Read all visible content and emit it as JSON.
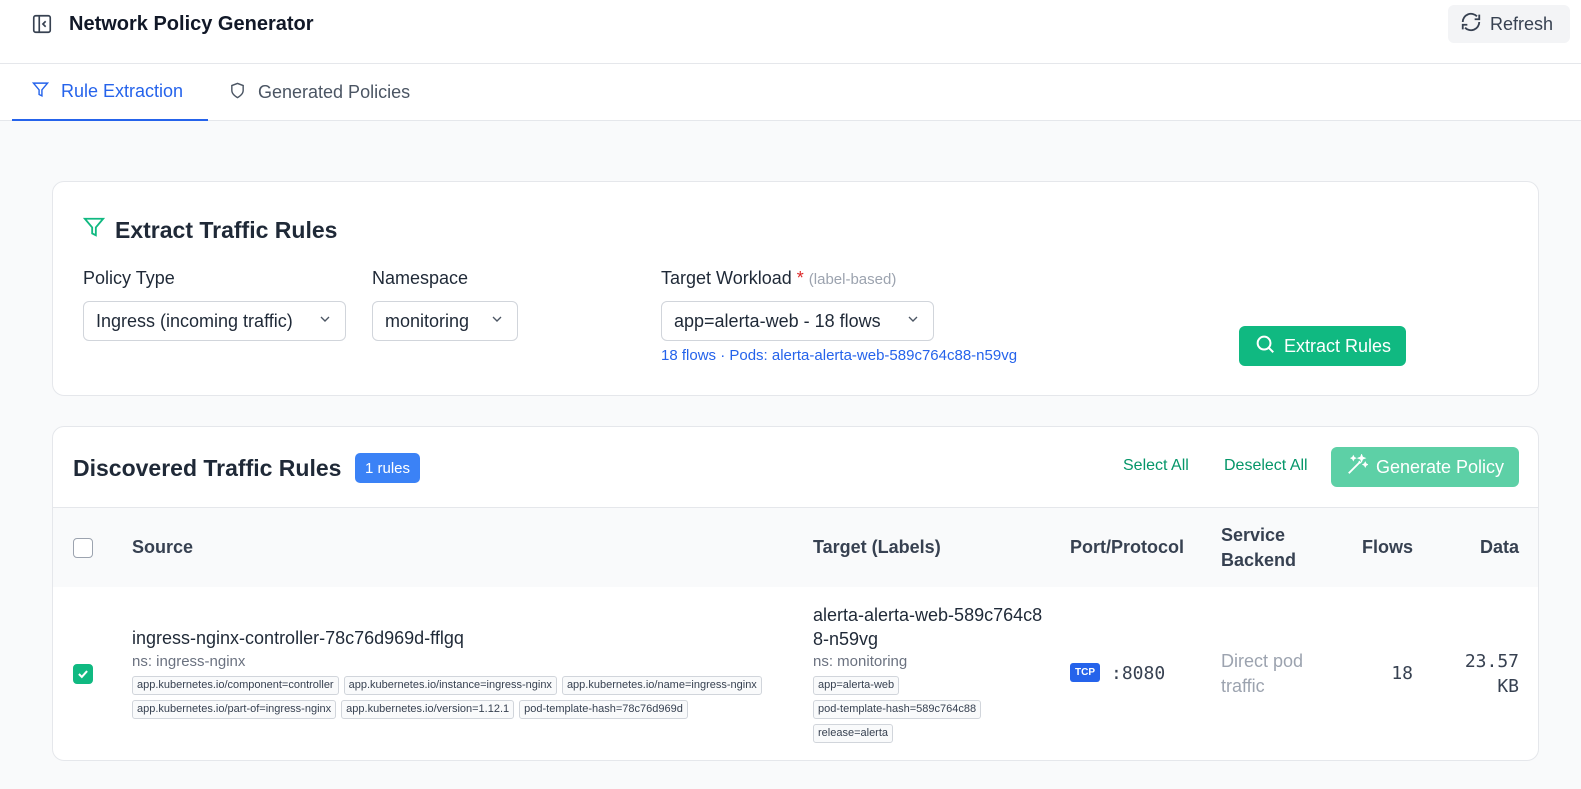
{
  "header": {
    "title": "Network Policy Generator",
    "refresh_label": "Refresh"
  },
  "tabs": [
    {
      "label": "Rule Extraction",
      "active": true,
      "icon": "filter-icon"
    },
    {
      "label": "Generated Policies",
      "active": false,
      "icon": "shield-icon"
    }
  ],
  "extract": {
    "title": "Extract Traffic Rules",
    "policy_type": {
      "label": "Policy Type",
      "value": "Ingress (incoming traffic)"
    },
    "namespace": {
      "label": "Namespace",
      "value": "monitoring"
    },
    "workload": {
      "label": "Target Workload",
      "required_mark": "*",
      "hint": "(label-based)",
      "value": "app=alerta-web - 18 flows",
      "info": "18 flows · Pods: alerta-alerta-web-589c764c88-n59vg"
    },
    "extract_label": "Extract Rules"
  },
  "rules": {
    "title": "Discovered Traffic Rules",
    "count_badge": "1 rules",
    "select_all": "Select All",
    "deselect_all": "Deselect All",
    "generate_label": "Generate Policy",
    "columns": {
      "source": "Source",
      "target": "Target (Labels)",
      "port": "Port/Protocol",
      "backend_line1": "Service",
      "backend_line2": "Backend",
      "flows": "Flows",
      "data": "Data"
    },
    "rows": [
      {
        "checked": true,
        "source_name": "ingress-nginx-controller-78c76d969d-fflgq",
        "source_ns": "ns: ingress-nginx",
        "source_labels": [
          "app.kubernetes.io/component=controller",
          "app.kubernetes.io/instance=ingress-nginx",
          "app.kubernetes.io/name=ingress-nginx",
          "app.kubernetes.io/part-of=ingress-nginx",
          "app.kubernetes.io/version=1.12.1",
          "pod-template-hash=78c76d969d"
        ],
        "target_name": "alerta-alerta-web-589c764c88-n59vg",
        "target_ns": "ns: monitoring",
        "target_labels": [
          "app=alerta-web",
          "pod-template-hash=589c764c88",
          "release=alerta"
        ],
        "protocol": "TCP",
        "port": ":8080",
        "backend": "Direct pod traffic",
        "flows": "18",
        "data": "23.57 KB"
      }
    ]
  },
  "colors": {
    "accent_green": "#10b981",
    "accent_blue": "#2563eb",
    "generate_disabled": "#5dd0a6"
  }
}
